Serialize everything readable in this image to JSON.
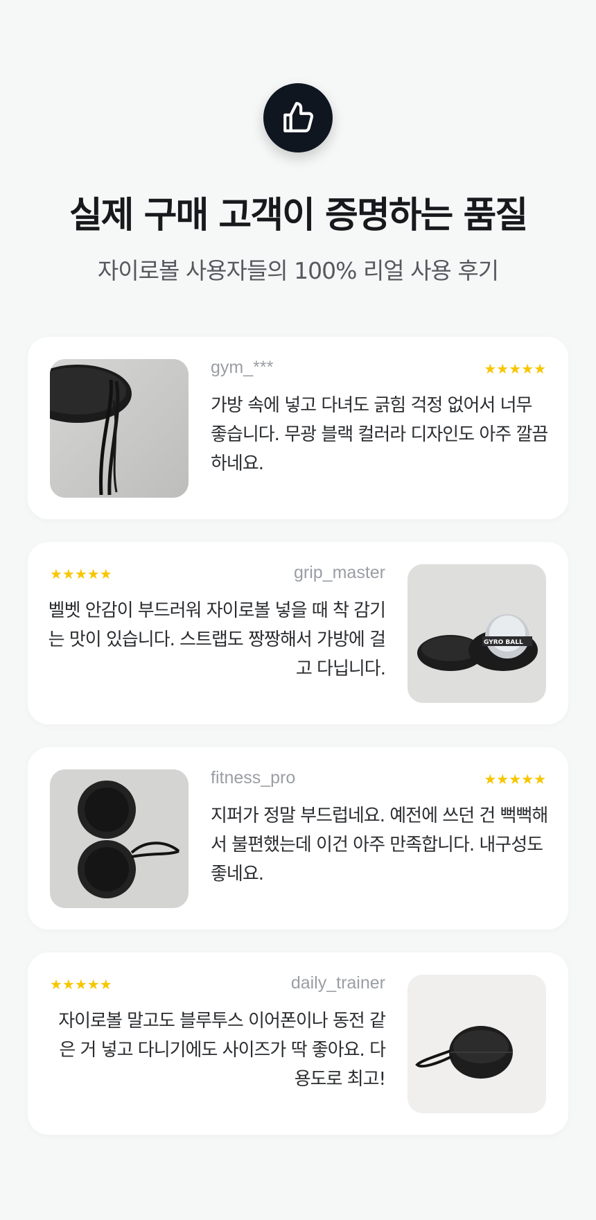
{
  "header": {
    "icon": "thumbs-up-icon",
    "title": "실제 구매 고객이 증명하는 품질",
    "subtitle": "자이로볼 사용자들의 100% 리얼 사용 후기"
  },
  "colors": {
    "background": "#f6f7f7",
    "badge": "#0f1620",
    "star": "#f7c600",
    "username": "#9a9ea3"
  },
  "reviews": [
    {
      "user": "gym_***",
      "rating": 5,
      "stars": "★★★★★",
      "text": "가방 속에 넣고 다녀도 긁힘 걱정 없어서 너무 좋습니다. 무광 블랙 컬러라 디자인도 아주 깔끔하네요.",
      "image": "case-strap-closeup-photo"
    },
    {
      "user": "grip_master",
      "rating": 5,
      "stars": "★★★★★",
      "text": "벨벳 안감이 부드러워 자이로볼 넣을 때 착 감기는 맛이 있습니다. 스트랩도 짱짱해서 가방에 걸고 다닙니다.",
      "image": "open-case-gyro-ball-photo"
    },
    {
      "user": "fitness_pro",
      "rating": 5,
      "stars": "★★★★★",
      "text": "지퍼가 정말 부드럽네요. 예전에 쓰던 건 뻑뻑해서 불편했는데 이건 아주 만족합니다. 내구성도 좋네요.",
      "image": "open-case-top-view-photo"
    },
    {
      "user": "daily_trainer",
      "rating": 5,
      "stars": "★★★★★",
      "text": "자이로볼 말고도 블루투스 이어폰이나 동전 같은 거 넣고 다니기에도 사이즈가 딱 좋아요. 다용도로 최고!",
      "image": "closed-case-photo"
    }
  ]
}
